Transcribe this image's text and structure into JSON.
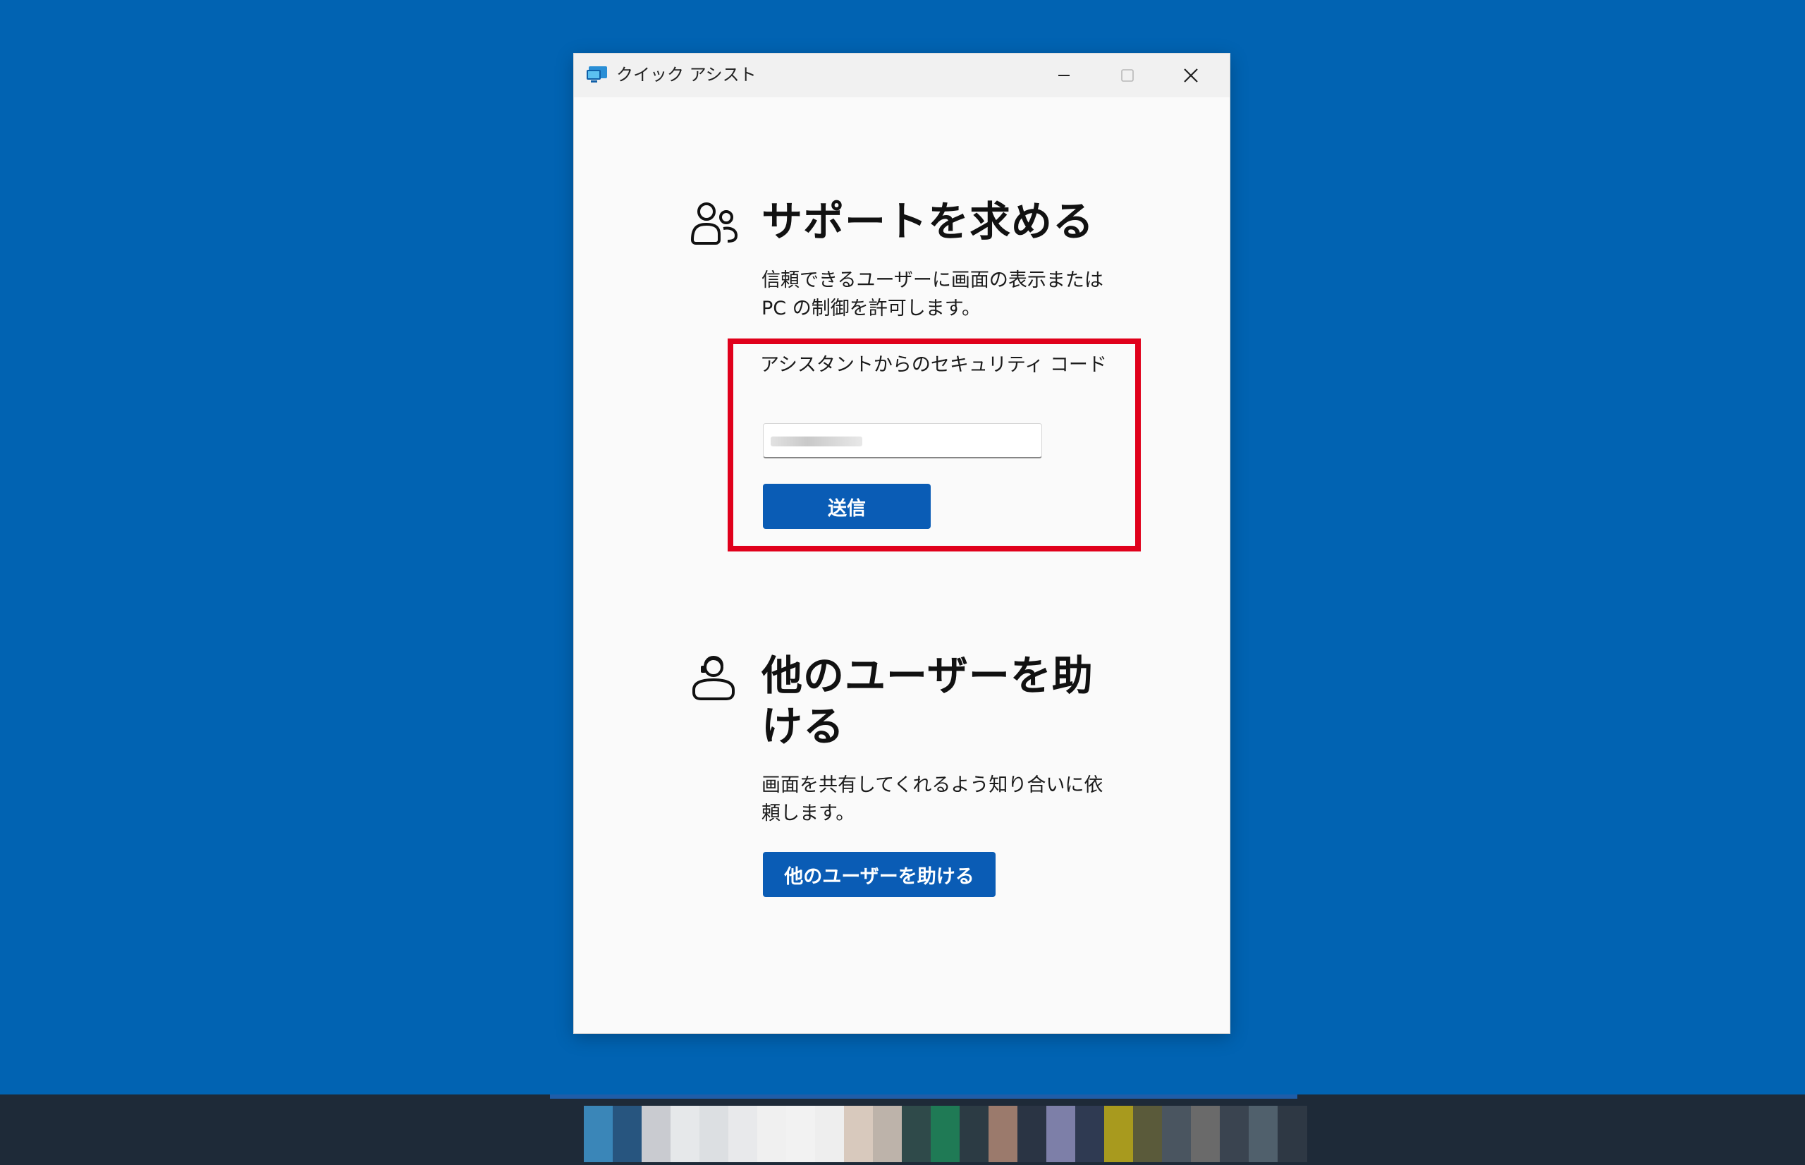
{
  "window": {
    "title": "クイック アシスト"
  },
  "get_help": {
    "heading": "サポートを求める",
    "description": "信頼できるユーザーに画面の表示または PC の制御を許可します。",
    "code_label": "アシスタントからのセキュリティ コード",
    "code_value": "",
    "submit_label": "送信"
  },
  "give_help": {
    "heading": "他のユーザーを助ける",
    "description": "画面を共有してくれるよう知り合いに依頼します。",
    "button_label": "他のユーザーを助ける"
  },
  "colors": {
    "desktop": "#0163b2",
    "accent": "#0a5cb5",
    "highlight_border": "#e0001b",
    "taskbar": "#1e2a38"
  },
  "taskbar": {
    "icons": [
      "app-icon",
      "app-icon",
      "app-icon",
      "app-icon",
      "app-icon",
      "app-icon",
      "app-icon",
      "app-icon",
      "app-icon",
      "app-icon",
      "app-icon",
      "app-icon",
      "app-icon",
      "app-icon",
      "app-icon",
      "app-icon",
      "app-icon",
      "app-icon",
      "app-icon",
      "app-icon",
      "app-icon",
      "app-icon",
      "app-icon",
      "app-icon",
      "app-icon"
    ]
  }
}
